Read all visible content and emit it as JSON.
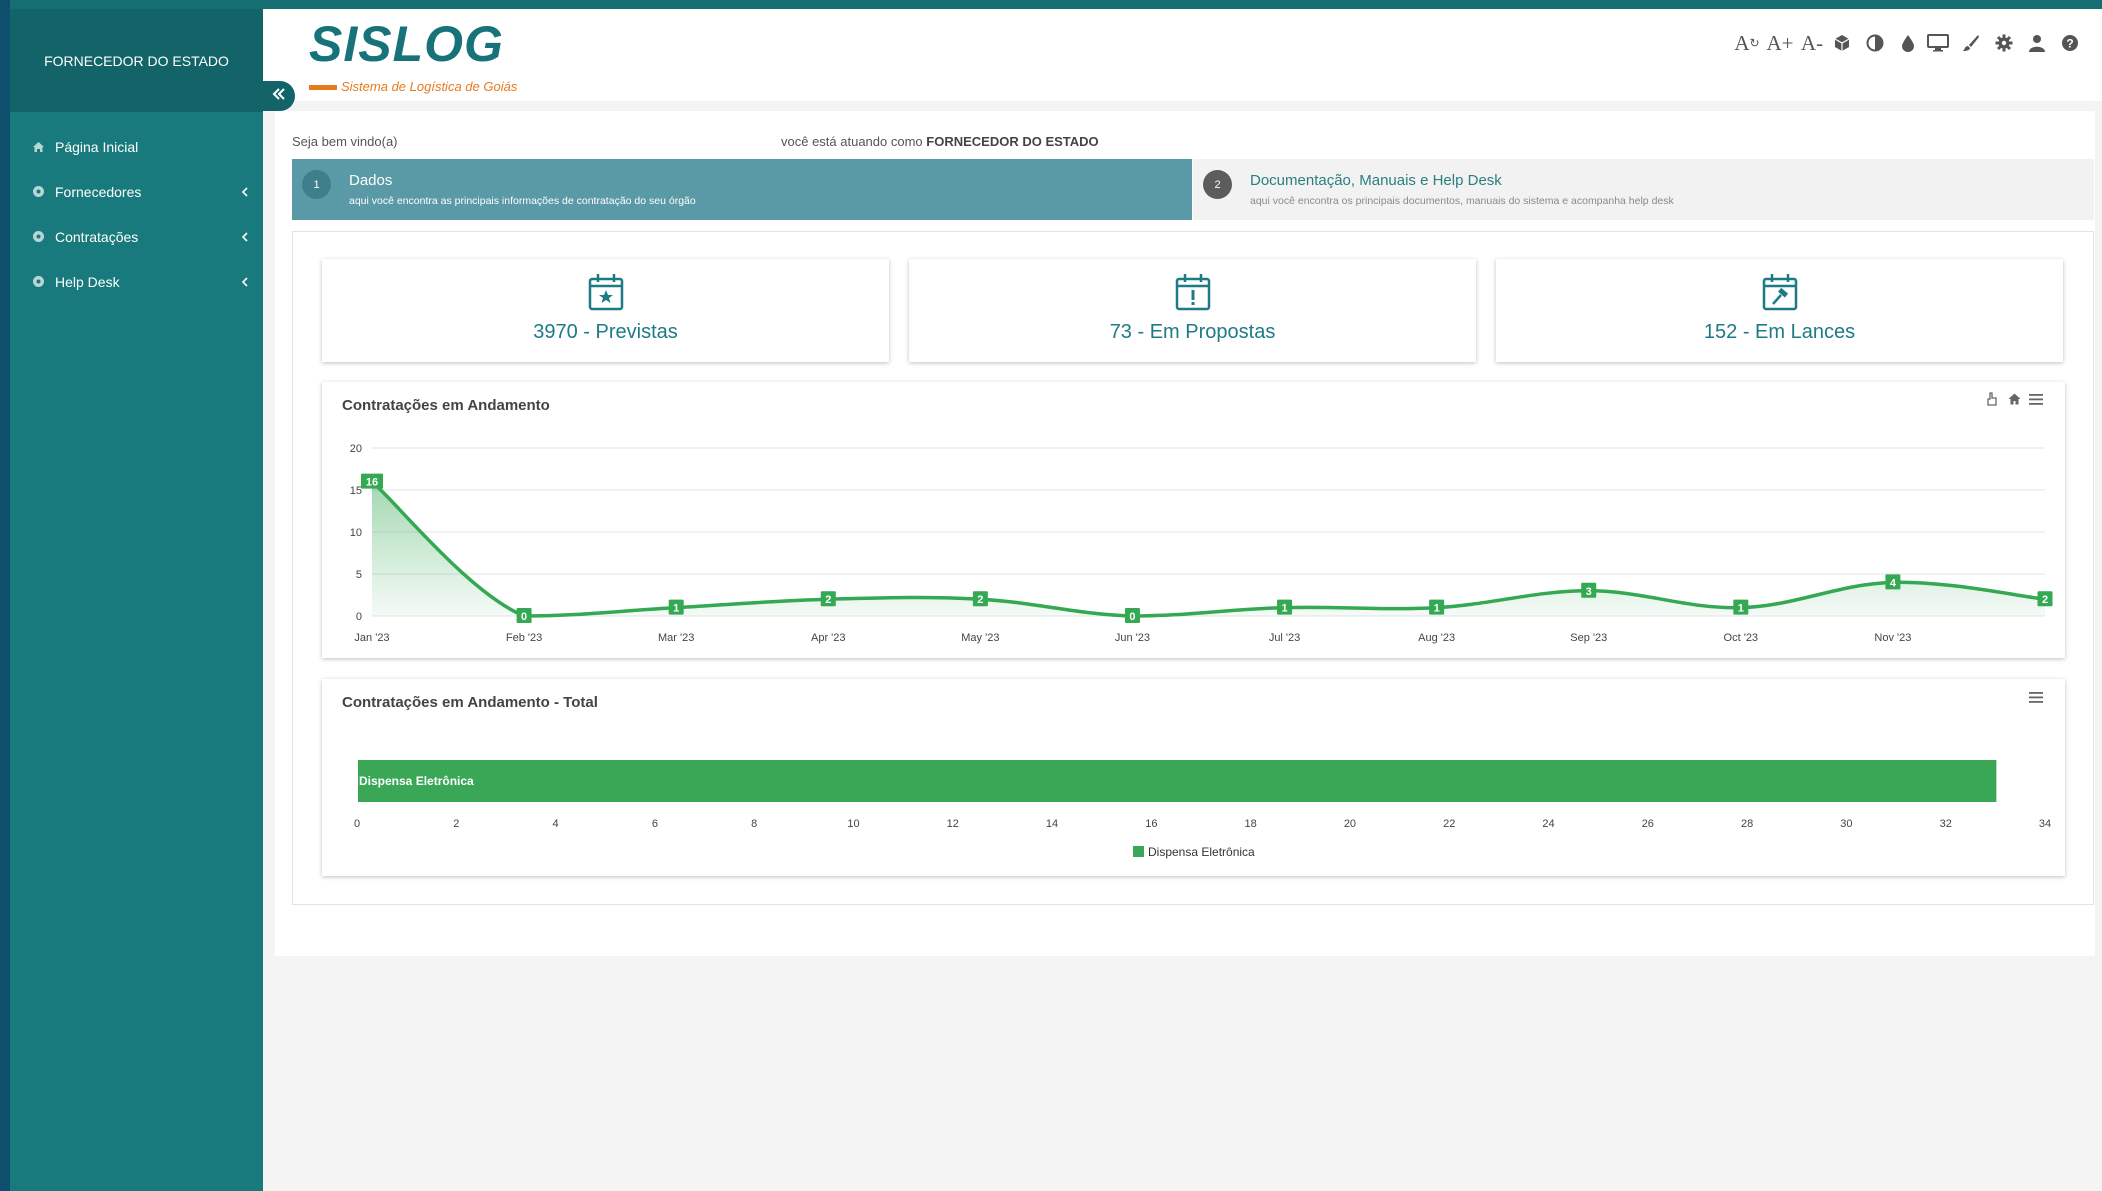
{
  "sidebar": {
    "header": "FORNECEDOR DO ESTADO",
    "items": [
      {
        "label": "Página Inicial"
      },
      {
        "label": "Fornecedores"
      },
      {
        "label": "Contratações"
      },
      {
        "label": "Help Desk"
      }
    ]
  },
  "logo": {
    "title": "SISLOG",
    "subtitle": "Sistema de Logística de Goiás"
  },
  "toolbar": {
    "icons": [
      "font-reset-icon",
      "font-increase-icon",
      "font-decrease-icon",
      "cube-icon",
      "contrast-icon",
      "water-drop-icon",
      "monitor-icon",
      "brush-icon",
      "gear-icon",
      "user-icon",
      "help-icon",
      "logout-icon"
    ],
    "font_reset_label": "A",
    "font_increase_label": "A+",
    "font_decrease_label": "A-"
  },
  "welcome": {
    "greeting": "Seja bem vindo(a)",
    "role_prefix": "você está atuando como",
    "role": "FORNECEDOR DO ESTADO"
  },
  "steps": [
    {
      "number": "1",
      "title": "Dados",
      "subtitle": "aqui você encontra as principais informações de contratação do seu órgão"
    },
    {
      "number": "2",
      "title": "Documentação, Manuais e Help Desk",
      "subtitle": "aqui você encontra os principais documentos, manuais do sistema e acompanha help desk"
    }
  ],
  "cards": [
    {
      "label": "3970 - Previstas",
      "icon": "calendar-star-icon"
    },
    {
      "label": "73 - Em Propostas",
      "icon": "calendar-alert-icon"
    },
    {
      "label": "152 - Em Lances",
      "icon": "calendar-gavel-icon"
    }
  ],
  "colors": {
    "primary": "#187a7d",
    "accent": "#34a853",
    "bar": "#3aa757",
    "card_text": "#1e7b85"
  },
  "chart_data": [
    {
      "type": "area",
      "title": "Contratações em Andamento",
      "x": [
        "Jan '23",
        "Feb '23",
        "Mar '23",
        "Apr '23",
        "May '23",
        "Jun '23",
        "Jul '23",
        "Aug '23",
        "Sep '23",
        "Oct '23",
        "Nov '23",
        ""
      ],
      "values": [
        16,
        0,
        1,
        2,
        2,
        0,
        1,
        1,
        3,
        1,
        4,
        2
      ],
      "y_ticks": [
        "0",
        "5",
        "10",
        "15",
        "20"
      ],
      "ylim": [
        0,
        20
      ],
      "grid": true,
      "data_labels": true
    },
    {
      "type": "bar",
      "orientation": "horizontal",
      "title": "Contratações em Andamento - Total",
      "categories": [
        "Dispensa Eletrônica"
      ],
      "series": [
        {
          "name": "Dispensa Eletrônica",
          "values": [
            33
          ]
        }
      ],
      "x_ticks": [
        "0",
        "2",
        "4",
        "6",
        "8",
        "10",
        "12",
        "14",
        "16",
        "18",
        "20",
        "22",
        "24",
        "26",
        "28",
        "30",
        "32",
        "34"
      ],
      "xlim": [
        0,
        34
      ],
      "legend": "bottom-center"
    }
  ]
}
